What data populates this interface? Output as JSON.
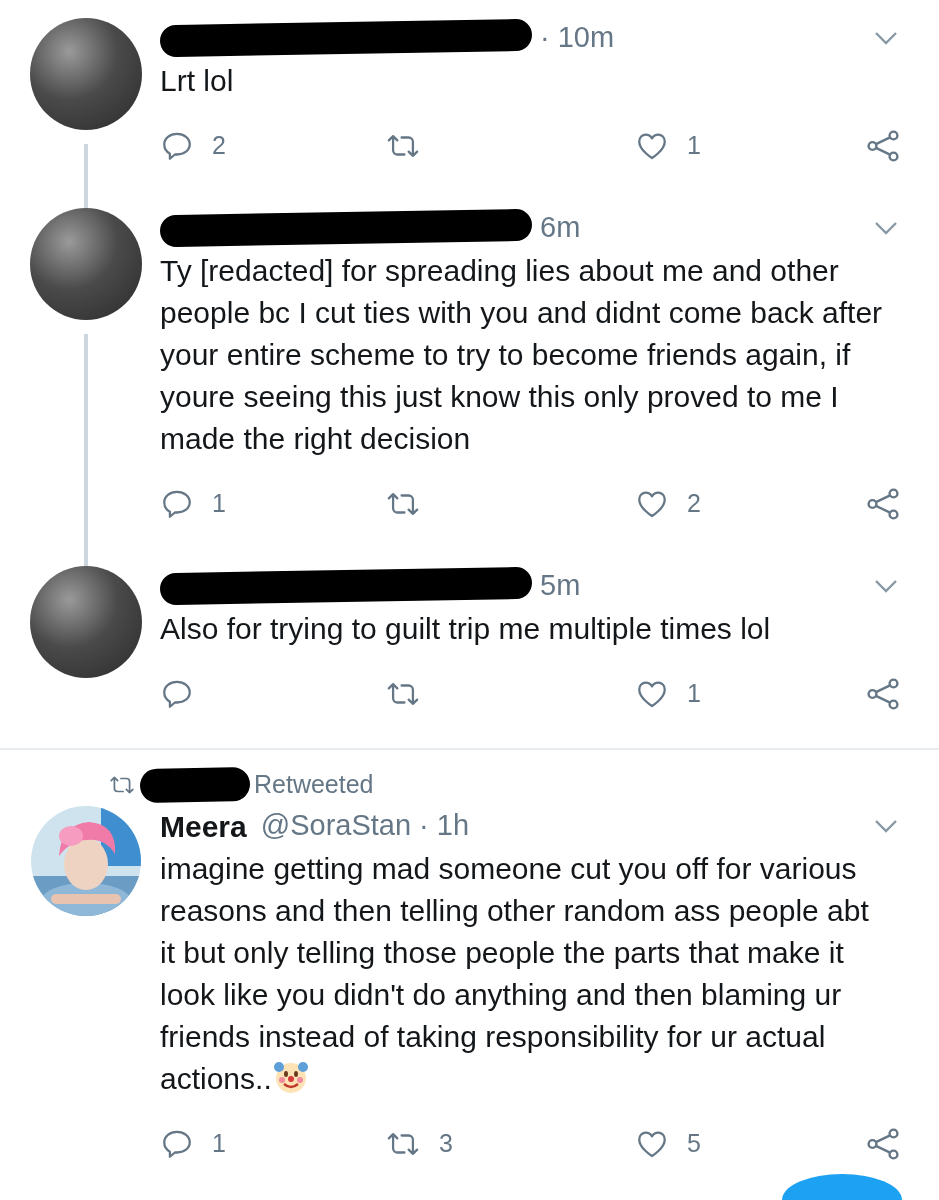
{
  "tweets": [
    {
      "author": {
        "redacted": true
      },
      "avatar": {
        "kind": "redacted"
      },
      "time": "· 10m",
      "text": "Lrt lol",
      "thread_line": true,
      "counts": {
        "replies": "2",
        "likes": "1"
      }
    },
    {
      "author": {
        "redacted": true
      },
      "avatar": {
        "kind": "redacted"
      },
      "time": "6m",
      "text": "Ty [redacted] for spreading lies about me and other people bc I cut ties with you and didnt come back after your entire scheme to try to become friends again, if youre seeing this just know this only proved to me I made the right decision",
      "thread_line": true,
      "counts": {
        "replies": "1",
        "likes": "2"
      }
    },
    {
      "author": {
        "redacted": true
      },
      "avatar": {
        "kind": "redacted"
      },
      "time": "5m",
      "text": "Also for trying to guilt trip me multiple times lol",
      "thread_line": false,
      "counts": {
        "likes": "1"
      }
    },
    {
      "retweeted_by": {
        "redacted": true,
        "label": "Retweeted"
      },
      "author": {
        "redacted": false,
        "name": "Meera",
        "handle": "@SoraStan"
      },
      "time": "· 1h",
      "text": "imagine getting mad someone cut you off for various reasons and then telling other random ass people abt it but only telling those people the parts that make it look like you didn't do anything and then blaming ur friends instead of taking responsibility for ur actual actions..",
      "end_emoji": {
        "kind": "clown"
      },
      "thread_line": false,
      "counts": {
        "replies": "1",
        "retweets": "3",
        "likes": "5"
      }
    }
  ]
}
